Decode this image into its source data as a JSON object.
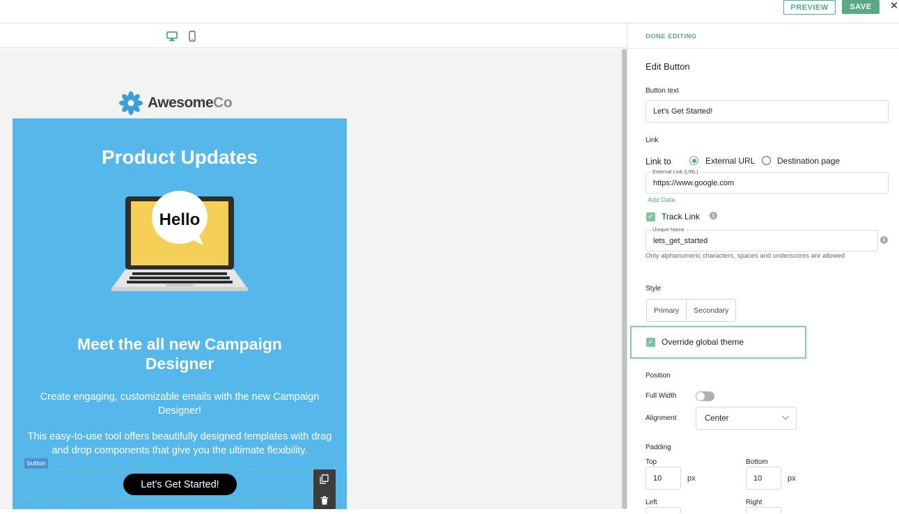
{
  "toolbar": {
    "preview_label": "PREVIEW",
    "save_label": "SAVE",
    "close_glyph": "✕"
  },
  "device": {
    "desktop_icon": "desktop-icon",
    "mobile_icon": "mobile-icon"
  },
  "email": {
    "logo_main": "Awesome",
    "logo_suffix": "Co",
    "title": "Product Updates",
    "image_text": "Hello",
    "heading": "Meet the all new Campaign Designer",
    "paragraph1": "Create engaging, customizable emails with the new Campaign Designer!",
    "paragraph2": "This easy-to-use tool offers beautifully designed templates with drag and drop components that give you the ultimate flexibility.",
    "block_tag": "button",
    "cta_label": "Let's Get Started!"
  },
  "panel": {
    "done_label": "DONE EDITING",
    "section_title": "Edit Button",
    "button_text_label": "Button text",
    "button_text_value": "Let's Get Started!",
    "link_section": "Link",
    "link_to_label": "Link to",
    "link_options": [
      "External URL",
      "Destination page"
    ],
    "link_selected": "External URL",
    "url_label": "External Link (URL)",
    "url_value": "https://www.google.com",
    "add_data": "Add Data",
    "track_link_label": "Track Link",
    "track_link_checked": true,
    "unique_name_label": "Unique Name",
    "unique_name_value": "lets_get_started",
    "unique_name_hint": "Only alphanumeric characters, spaces and underscores are allowed",
    "style_label": "Style",
    "style_options": [
      "Primary",
      "Secondary"
    ],
    "override_label": "Override global theme",
    "override_checked": true,
    "position_label": "Position",
    "full_width_label": "Full Width",
    "full_width_on": false,
    "alignment_label": "Alignment",
    "alignment_value": "Center",
    "padding_label": "Padding",
    "padding": {
      "top_label": "Top",
      "top_value": "10",
      "bottom_label": "Bottom",
      "bottom_value": "10",
      "left_label": "Left",
      "right_label": "Right",
      "unit": "px"
    }
  },
  "colors": {
    "accent": "#5aa884",
    "email_bg": "#56b7ea",
    "cta_bg": "#000000",
    "highlight": "#8ccfa6"
  }
}
